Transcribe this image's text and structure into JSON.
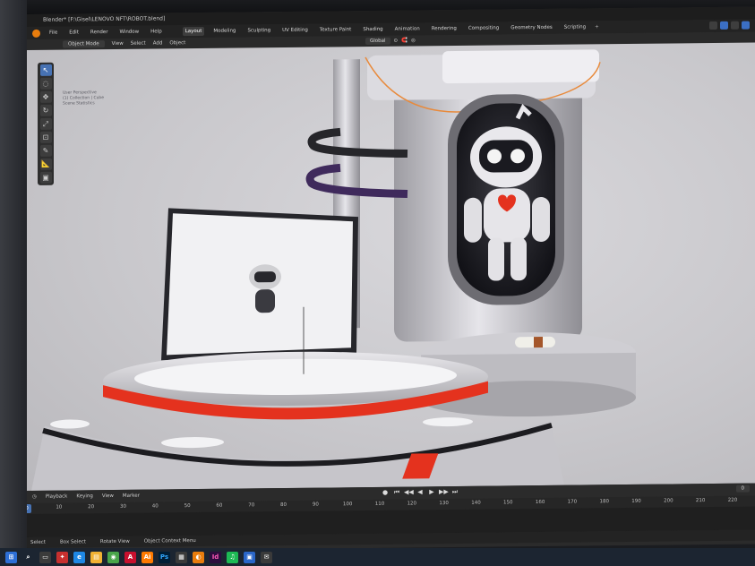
{
  "window": {
    "title": "Blender* [F:\\Gisel\\LENOVO NFT\\ROBOT.blend]"
  },
  "menu": {
    "items": [
      "File",
      "Edit",
      "Render",
      "Window",
      "Help"
    ],
    "workspaces": [
      "Layout",
      "Modeling",
      "Sculpting",
      "UV Editing",
      "Texture Paint",
      "Shading",
      "Animation",
      "Rendering",
      "Compositing",
      "Geometry Nodes",
      "Scripting"
    ],
    "active_workspace": "Layout",
    "add_tab": "+"
  },
  "viewport_header": {
    "mode": "Object Mode",
    "items": [
      "View",
      "Select",
      "Add",
      "Object"
    ],
    "transform_orientation": "Global"
  },
  "viewport_info": [
    "User Perspective",
    "(1) Collection | Cube",
    "Scene Statistics"
  ],
  "toolbar": {
    "tools": [
      "cursor-arrow",
      "select-circle",
      "move",
      "rotate",
      "scale",
      "transform",
      "annotate",
      "measure",
      "add-cube"
    ]
  },
  "timeline": {
    "menu": [
      "Playback",
      "Keying",
      "View",
      "Marker"
    ],
    "current_frame": "0",
    "ticks": [
      "0",
      "10",
      "20",
      "30",
      "40",
      "50",
      "60",
      "70",
      "80",
      "90",
      "100",
      "110",
      "120",
      "130",
      "140",
      "150",
      "160",
      "170",
      "180",
      "190",
      "200",
      "210",
      "220"
    ]
  },
  "statusbar": {
    "items": [
      "Select",
      "Box Select",
      "Rotate View",
      "Object Context Menu"
    ]
  },
  "colors": {
    "blender_orange": "#e87d0d",
    "accent_blue": "#4772b3",
    "robot_red": "#e4321e",
    "viewport_bg": "#cfced2"
  }
}
